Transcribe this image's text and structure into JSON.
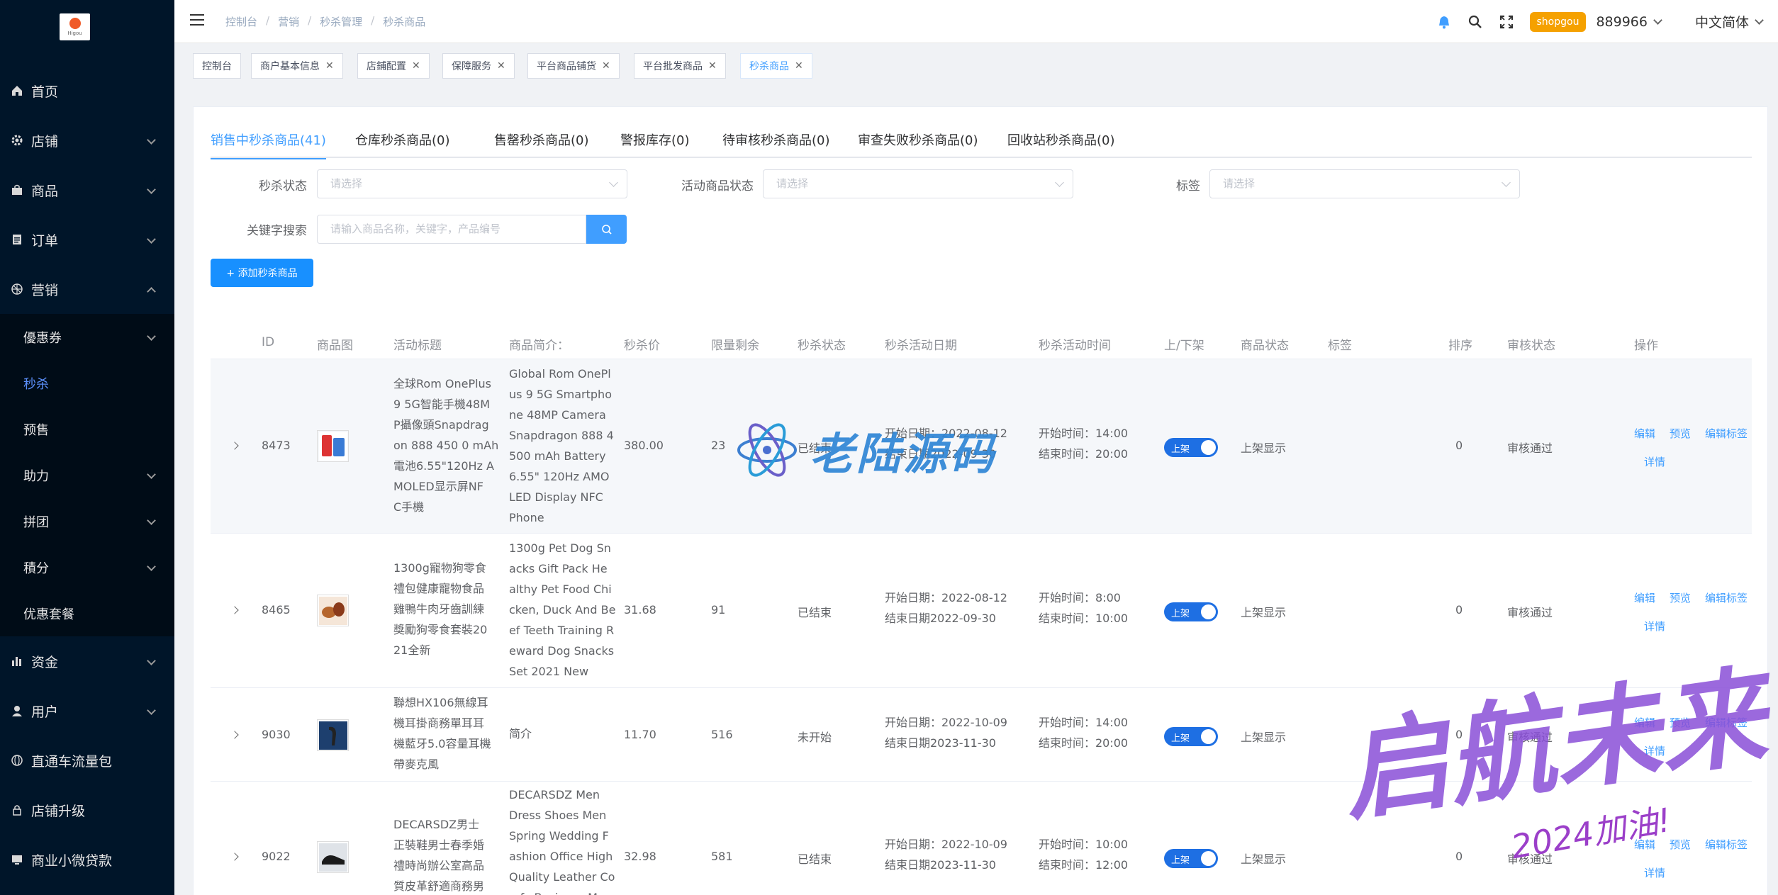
{
  "logo": {
    "text": "Higou"
  },
  "sidebar": {
    "items": [
      {
        "label": "首页",
        "icon": "home-icon"
      },
      {
        "label": "店铺",
        "icon": "gear-icon"
      },
      {
        "label": "商品",
        "icon": "bag-icon"
      },
      {
        "label": "订单",
        "icon": "document-icon"
      },
      {
        "label": "营销",
        "icon": "target-icon"
      }
    ],
    "sub_items": [
      {
        "label": "優惠券"
      },
      {
        "label": "秒杀"
      },
      {
        "label": "预售"
      },
      {
        "label": "助力"
      },
      {
        "label": "拼团"
      },
      {
        "label": "積分"
      },
      {
        "label": "优惠套餐"
      }
    ],
    "bottom_items": [
      {
        "label": "资金",
        "icon": "bar-chart-icon"
      },
      {
        "label": "用户",
        "icon": "user-icon"
      },
      {
        "label": "直通车流量包",
        "icon": "globe-icon"
      },
      {
        "label": "店铺升级",
        "icon": "lock-icon"
      },
      {
        "label": "商业小微贷款",
        "icon": "monitor-icon"
      }
    ]
  },
  "header": {
    "breadcrumb": [
      "控制台",
      "营销",
      "秒杀管理",
      "秒杀商品"
    ],
    "shop_badge": "shopgou",
    "shop_number": "889966",
    "language": "中文简体"
  },
  "tags": [
    {
      "label": "控制台"
    },
    {
      "label": "商户基本信息"
    },
    {
      "label": "店鋪配置"
    },
    {
      "label": "保障服务"
    },
    {
      "label": "平台商品铺货"
    },
    {
      "label": "平台批发商品"
    },
    {
      "label": "秒杀商品"
    }
  ],
  "tabs": [
    "销售中秒杀商品(41)",
    "仓库秒杀商品(0)",
    "售罄秒杀商品(0)",
    "警报库存(0)",
    "待审核秒杀商品(0)",
    "审查失败秒杀商品(0)",
    "回收站秒杀商品(0)"
  ],
  "filters": {
    "seckill_status_label": "秒杀状态",
    "activity_status_label": "活动商品状态",
    "tag_label": "标签",
    "keyword_label": "关键字搜索",
    "select_placeholder": "请选择",
    "keyword_placeholder": "请输入商品名称，关键字，产品编号",
    "add_button": "+ 添加秒杀商品"
  },
  "columns": [
    "ID",
    "商品图",
    "活动标题",
    "商品简介：",
    "秒杀价",
    "限量剩余",
    "秒杀状态",
    "秒杀活动日期",
    "秒杀活动时间",
    "上/下架",
    "商品状态",
    "标签",
    "排序",
    "审核状态",
    "操作"
  ],
  "rows": [
    {
      "id": "8473",
      "title": [
        "全球Rom OnePlus",
        "9 5G智能手機48M",
        "P攝像頭Snapdrag",
        "on 888 450 0 mAh",
        "電池6.55\"120Hz A",
        "MOLED显示屏NF",
        "C手機"
      ],
      "intro": [
        "Global Rom OnePl",
        "us 9 5G Smartpho",
        "ne 48MP Camera",
        "Snapdragon 888 4",
        "500 mAh Battery",
        "6.55\" 120Hz AMO",
        "LED Display NFC",
        "Phone"
      ],
      "price": "380.00",
      "remain": "23",
      "status": "已结束",
      "date_start": "开始日期：2022-08-12",
      "date_end": "结束日期2022-09-30",
      "time_start": "开始时间：14:00",
      "time_end": "结束时间：20:00",
      "shelf": "上架",
      "goods_status": "上架显示",
      "sort": "0",
      "audit": "审核通过"
    },
    {
      "id": "8465",
      "title": [
        "1300g寵物狗零食",
        "禮包健康寵物食品",
        "雞鴨牛肉牙齒訓練",
        "獎勵狗零食套裝20",
        "21全新"
      ],
      "intro": [
        "1300g Pet Dog Sn",
        "acks Gift Pack He",
        "althy Pet Food Chi",
        "cken, Duck And Be",
        "ef Teeth Training R",
        "eward Dog Snacks",
        "Set 2021 New"
      ],
      "price": "31.68",
      "remain": "91",
      "status": "已结束",
      "date_start": "开始日期：2022-08-12",
      "date_end": "结束日期2022-09-30",
      "time_start": "开始时间：8:00",
      "time_end": "结束时间：10:00",
      "shelf": "上架",
      "goods_status": "上架显示",
      "sort": "0",
      "audit": "审核通过"
    },
    {
      "id": "9030",
      "title": [
        "聯想HX106無線耳",
        "機耳掛商務單耳耳",
        "機藍牙5.0容量耳機",
        "帶麥克風"
      ],
      "intro": [
        "简介"
      ],
      "price": "11.70",
      "remain": "516",
      "status": "未开始",
      "date_start": "开始日期：2022-10-09",
      "date_end": "结束日期2023-11-30",
      "time_start": "开始时间：14:00",
      "time_end": "结束时间：20:00",
      "shelf": "上架",
      "goods_status": "上架显示",
      "sort": "0",
      "audit": "审核通过"
    },
    {
      "id": "9022",
      "title": [
        "DECARSDZ男士",
        "正裝鞋男士春季婚",
        "禮時尚辦公室高品",
        "質皮革舒適商務男"
      ],
      "intro": [
        "DECARSDZ Men",
        "Dress Shoes Men",
        "Spring Wedding F",
        "ashion Office High",
        "Quality Leather Co",
        "mfy Business Man"
      ],
      "price": "32.98",
      "remain": "581",
      "status": "已结束",
      "date_start": "开始日期：2022-10-09",
      "date_end": "结束日期2023-11-30",
      "time_start": "开始时间：10:00",
      "time_end": "结束时间：12:00",
      "shelf": "上架",
      "goods_status": "上架显示",
      "sort": "0",
      "audit": "审核通过"
    }
  ],
  "ops": {
    "edit": "编辑",
    "preview": "预览",
    "edit_tag": "编辑标签",
    "detail": "详情"
  },
  "watermarks": {
    "center": "老陆源码",
    "corner_big": "启航未来",
    "corner_small": "2024加油!"
  },
  "colors": {
    "primary": "#409eff",
    "sidebar": "#001529",
    "badge": "#f5a100",
    "toggle": "#1e6fe3"
  }
}
